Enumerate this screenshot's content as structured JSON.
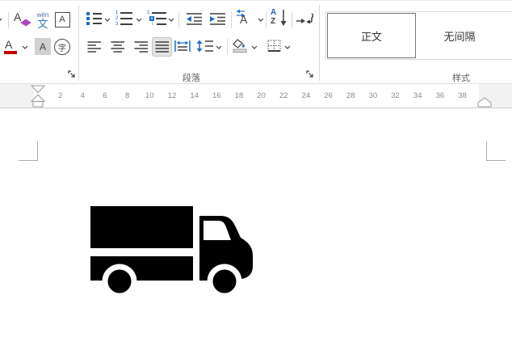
{
  "colors": {
    "accent_blue": "#1f6cc0",
    "font_color_red": "#c00000",
    "clear_format_purple": "#a94bbf",
    "icon_gray": "#3f3f3f"
  },
  "ribbon": {
    "font_group": {
      "clear_formatting_letter": "A",
      "phonetic_guide_pinyin": "wén",
      "phonetic_guide_char": "文",
      "character_border_letter": "A",
      "font_color_letter": "A",
      "character_shading_letter": "A",
      "enclose_character": "字"
    },
    "paragraph_group": {
      "label": "段落",
      "numbering_digits": [
        "1",
        "2",
        "3"
      ],
      "multilevel_items": [
        "1",
        "a",
        "i"
      ],
      "sort_letter_top": "A",
      "sort_letter_bottom": "Z",
      "asian_layout_letter": "A"
    },
    "styles_group": {
      "label": "样式",
      "styles": [
        {
          "name": "正文",
          "selected": true
        },
        {
          "name": "无间隔",
          "selected": false
        }
      ]
    }
  },
  "ruler": {
    "unit_numbers": [
      2,
      4,
      6,
      8,
      10,
      12,
      14,
      16,
      18,
      20,
      22,
      24,
      26,
      28,
      30,
      32,
      34,
      36,
      38
    ]
  },
  "document": {
    "content_image": "black delivery truck clip art"
  }
}
